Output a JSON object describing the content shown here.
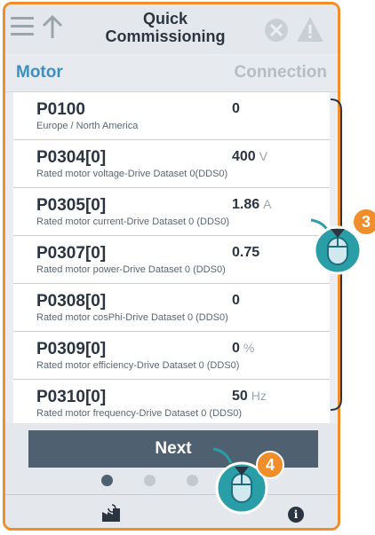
{
  "header": {
    "title_line1": "Quick",
    "title_line2": "Commissioning",
    "menu_icon": "hamburger-menu-icon",
    "up_icon": "up-arrow-icon",
    "fault_icon": "fault-icon",
    "warning_icon": "warning-icon"
  },
  "tabs": {
    "left": "Motor",
    "right": "Connection"
  },
  "params": [
    {
      "code": "P0100",
      "desc": "Europe / North America",
      "value": "0",
      "unit": ""
    },
    {
      "code": "P0304[0]",
      "desc": "Rated motor voltage-Drive Dataset 0(DDS0)",
      "value": "400",
      "unit": "V"
    },
    {
      "code": "P0305[0]",
      "desc": "Rated motor current-Drive Dataset 0 (DDS0)",
      "value": "1.86",
      "unit": "A"
    },
    {
      "code": "P0307[0]",
      "desc": "Rated motor power-Drive Dataset 0 (DDS0)",
      "value": "0.75",
      "unit": ""
    },
    {
      "code": "P0308[0]",
      "desc": "Rated motor cosPhi-Drive Dataset 0 (DDS0)",
      "value": "0",
      "unit": ""
    },
    {
      "code": "P0309[0]",
      "desc": "Rated motor efficiency-Drive Dataset 0 (DDS0)",
      "value": "0",
      "unit": "%"
    },
    {
      "code": "P0310[0]",
      "desc": "Rated motor frequency-Drive Dataset 0 (DDS0)",
      "value": "50",
      "unit": "Hz"
    }
  ],
  "footer": {
    "next_label": "Next",
    "page_dots": 4,
    "active_dot": 0,
    "factory_icon": "factory-reset-icon",
    "info_icon": "info-icon",
    "info_glyph": "i"
  },
  "callouts": [
    {
      "number": "3",
      "icon": "mouse-scroll-icon"
    },
    {
      "number": "4",
      "icon": "mouse-click-icon"
    }
  ],
  "colors": {
    "accent_orange": "#ef8e2a",
    "tab_active": "#3d8fc0",
    "next_button": "#4f6070",
    "callout_teal": "#2a9ea6"
  }
}
